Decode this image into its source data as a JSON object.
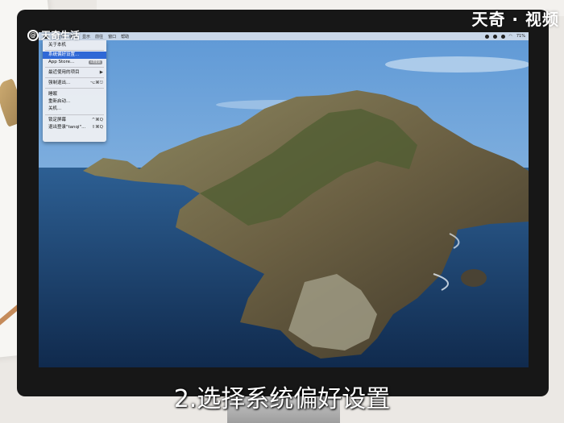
{
  "watermark": {
    "brand_left": "天奇生活",
    "brand_right": "天奇 · 视频"
  },
  "menubar": {
    "items": [
      "",
      "文件",
      "编辑",
      "显示",
      "前往",
      "窗口",
      "帮助"
    ],
    "battery": "71%"
  },
  "apple_menu": {
    "items": [
      {
        "label": "关于本机"
      },
      {
        "label": "系统偏好设置...",
        "selected": true
      },
      {
        "label": "App Store...",
        "badge": "6项更新"
      },
      {
        "label": "最近使用的项目",
        "shortcut": "▶"
      },
      {
        "label": "强制退出...",
        "shortcut": "⌥⌘⎋"
      },
      {
        "label": "睡眠"
      },
      {
        "label": "重新启动..."
      },
      {
        "label": "关机..."
      },
      {
        "label": "锁定屏幕",
        "shortcut": "^⌘Q"
      },
      {
        "label": "退出登录\"tanqi\"...",
        "shortcut": "⇧⌘Q"
      }
    ]
  },
  "subtitle": "2.选择系统偏好设置",
  "colors": {
    "menu_highlight": "#2f68d6",
    "sea": "#2f5d8c",
    "sky": "#7fb3e6"
  }
}
